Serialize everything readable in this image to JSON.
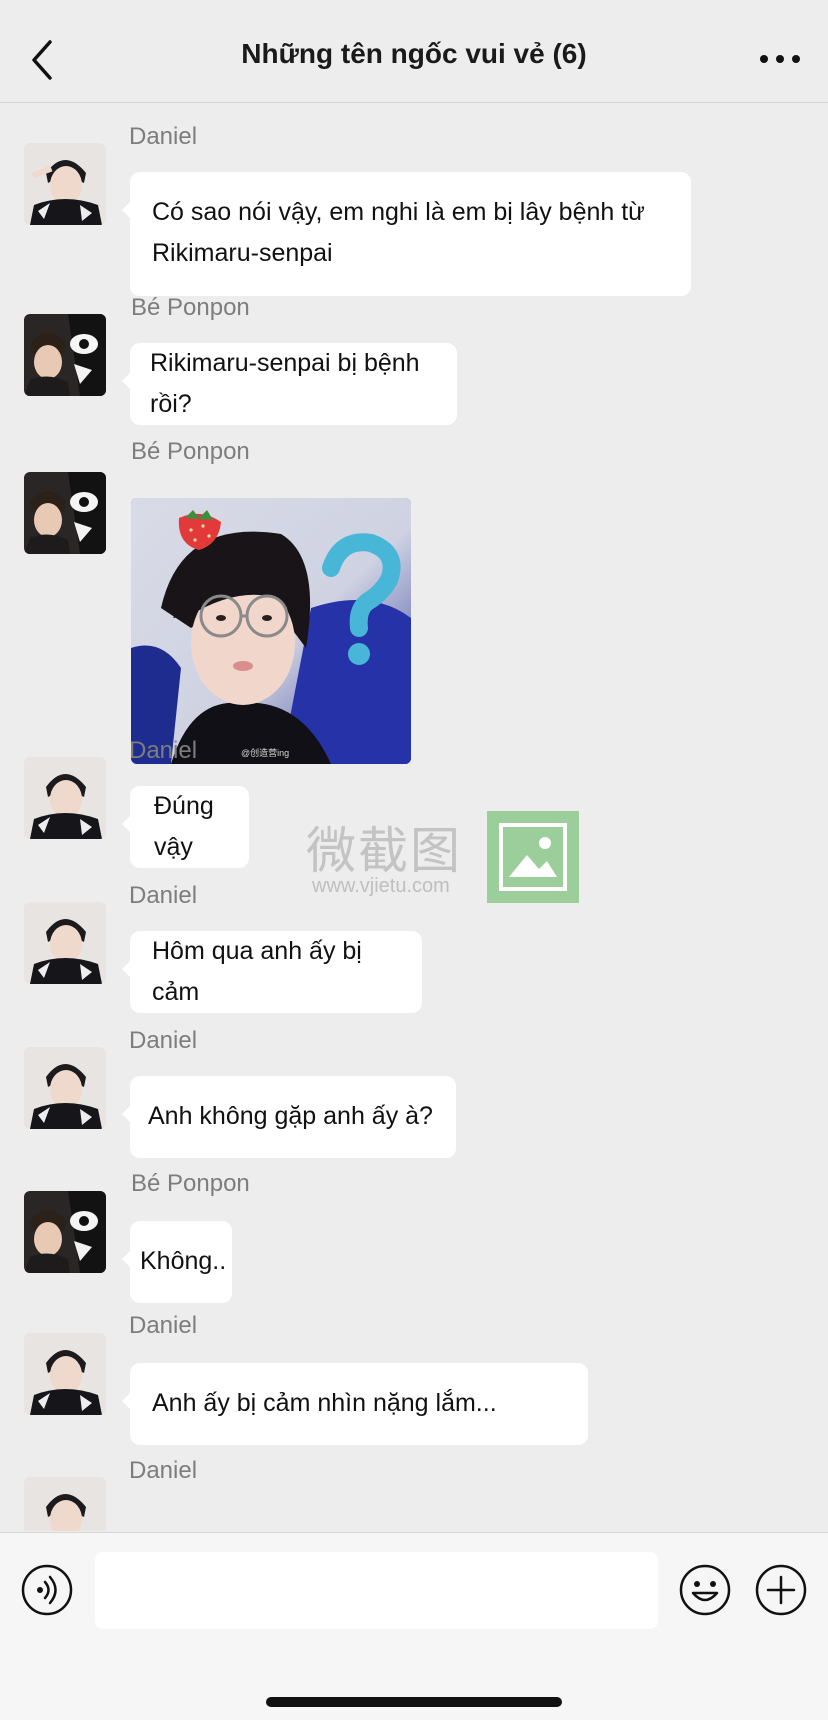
{
  "header": {
    "title": "Những tên ngốc vui vẻ (6)"
  },
  "messages": [
    {
      "sender": "Daniel",
      "text": "Có sao nói vậy, em nghi là em bị lây bệnh từ Rikimaru-senpai",
      "avatar": "daniel-avatar"
    },
    {
      "sender": "Bé Ponpon",
      "text": "Rikimaru-senpai bị bệnh rồi?",
      "avatar": "ponpon-avatar"
    },
    {
      "sender": "Bé Ponpon",
      "sticker": "boy-strawberry-question-sticker",
      "avatar": "ponpon-avatar"
    },
    {
      "sender": "Daniel",
      "text": "Đúng vậy",
      "avatar": "daniel-avatar"
    },
    {
      "sender": "Daniel",
      "text": "Hôm qua anh ấy bị cảm",
      "avatar": "daniel-avatar"
    },
    {
      "sender": "Daniel",
      "text": "Anh không gặp anh ấy à?",
      "avatar": "daniel-avatar"
    },
    {
      "sender": "Bé Ponpon",
      "text": "Không..",
      "avatar": "ponpon-avatar"
    },
    {
      "sender": "Daniel",
      "text": "Anh ấy bị cảm nhìn nặng lắm...",
      "avatar": "daniel-avatar"
    },
    {
      "sender": "Daniel",
      "avatar": "daniel-avatar"
    }
  ],
  "watermark": {
    "text": "微截图",
    "url": "www.vjietu.com"
  },
  "sticker_caption": "@创造营ing",
  "input": {
    "value": ""
  },
  "colors": {
    "background": "#ededed",
    "bubble": "#ffffff",
    "sender": "#7d7d7d"
  }
}
